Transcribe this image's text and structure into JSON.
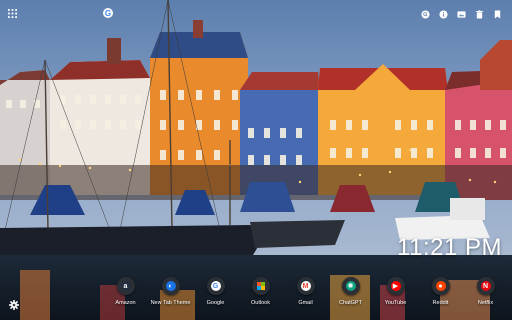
{
  "clock": {
    "time": "11:21 PM"
  },
  "top_left": {
    "apps_icon": "apps-grid-icon",
    "google_icon": "google-icon"
  },
  "top_right": [
    "search-icon",
    "info-icon",
    "wallpaper-icon",
    "trash-icon",
    "bookmark-icon"
  ],
  "shortcuts": [
    {
      "label": "Amazon",
      "icon": "amazon-icon",
      "color": "#232f3e",
      "glyph": "a"
    },
    {
      "label": "New Tab Theme",
      "icon": "new-tab-theme-icon",
      "color": "#1a73e8",
      "glyph": "◐"
    },
    {
      "label": "Google",
      "icon": "google-icon",
      "color": "#ffffff",
      "glyph": "G"
    },
    {
      "label": "Outlook",
      "icon": "microsoft-icon",
      "color": "#2b2f36",
      "glyph": ""
    },
    {
      "label": "Gmail",
      "icon": "gmail-icon",
      "color": "#ffffff",
      "glyph": "M"
    },
    {
      "label": "ChatGPT",
      "icon": "chatgpt-icon",
      "color": "#10a37f",
      "glyph": "✺"
    },
    {
      "label": "YouTube",
      "icon": "youtube-icon",
      "color": "#ff0000",
      "glyph": "▶"
    },
    {
      "label": "Reddit",
      "icon": "reddit-icon",
      "color": "#ff4500",
      "glyph": "●"
    },
    {
      "label": "Netflix",
      "icon": "netflix-icon",
      "color": "#e50914",
      "glyph": "N"
    }
  ],
  "settings_icon": "gear-icon"
}
